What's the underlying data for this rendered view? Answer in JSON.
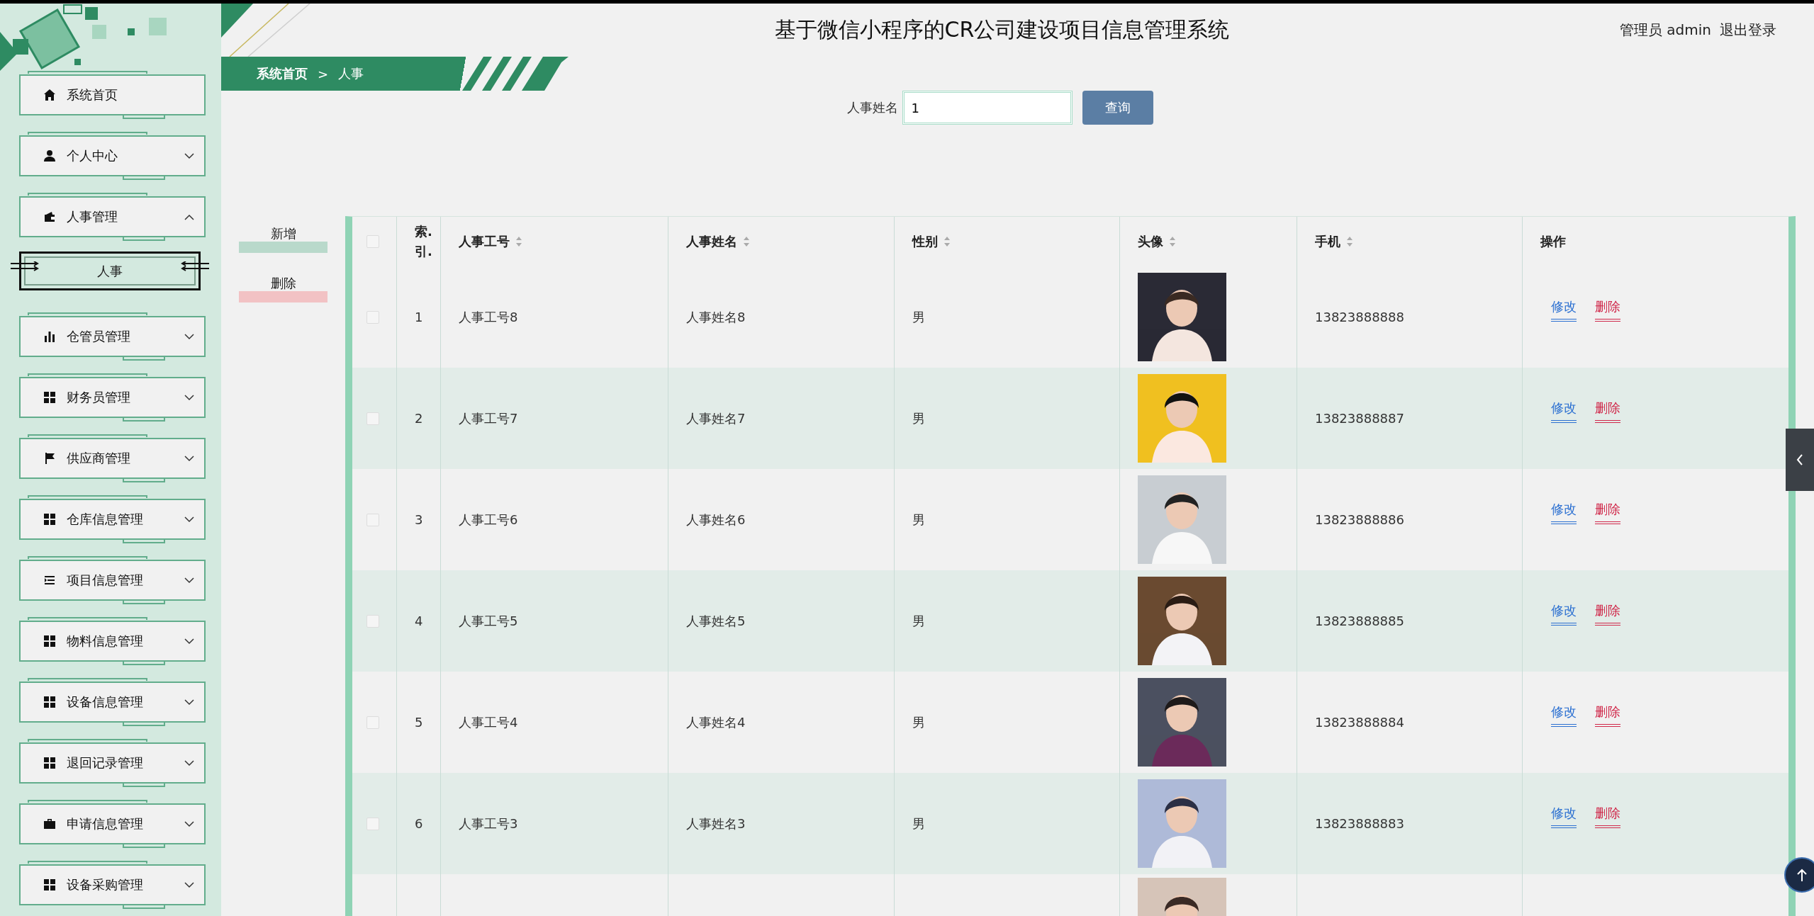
{
  "header": {
    "title": "基于微信小程序的CR公司建设项目信息管理系统",
    "user": "管理员 admin",
    "logout": "退出登录"
  },
  "sidebar": {
    "items": [
      {
        "kind": "link",
        "label": "系统首页"
      },
      {
        "kind": "menu",
        "label": "个人中心",
        "expanded": false
      },
      {
        "kind": "menu",
        "label": "人事管理",
        "expanded": true,
        "children": [
          {
            "label": "人事",
            "selected": true
          }
        ]
      },
      {
        "kind": "menu",
        "label": "仓管员管理",
        "expanded": false
      },
      {
        "kind": "menu",
        "label": "财务员管理",
        "expanded": false
      },
      {
        "kind": "menu",
        "label": "供应商管理",
        "expanded": false
      },
      {
        "kind": "menu",
        "label": "仓库信息管理",
        "expanded": false
      },
      {
        "kind": "menu",
        "label": "项目信息管理",
        "expanded": false
      },
      {
        "kind": "menu",
        "label": "物料信息管理",
        "expanded": false
      },
      {
        "kind": "menu",
        "label": "设备信息管理",
        "expanded": false
      },
      {
        "kind": "menu",
        "label": "退回记录管理",
        "expanded": false
      },
      {
        "kind": "menu",
        "label": "申请信息管理",
        "expanded": false
      },
      {
        "kind": "menu",
        "label": "设备采购管理",
        "expanded": false
      }
    ]
  },
  "breadcrumb": {
    "home": "系统首页",
    "separator": ">",
    "current": "人事"
  },
  "search": {
    "label": "人事姓名",
    "value": "1",
    "button": "查询"
  },
  "actions": [
    {
      "kind": "add",
      "label": "新增"
    },
    {
      "kind": "delete",
      "label": "删除"
    }
  ],
  "table": {
    "header_checkbox": {
      "checked": false
    },
    "columns": [
      {
        "label": "索.\n引.",
        "sortable": false
      },
      {
        "label": "人事工号",
        "sortable": true
      },
      {
        "label": "人事姓名",
        "sortable": true
      },
      {
        "label": "性别",
        "sortable": true
      },
      {
        "label": "头像",
        "sortable": true
      },
      {
        "label": "手机",
        "sortable": true
      },
      {
        "label": "操作",
        "sortable": false
      }
    ],
    "rows": [
      {
        "kind": "data",
        "selected": false,
        "index": "1",
        "staff_no": "人事工号8",
        "name": "人事姓名8",
        "gender": "男",
        "phone": "13823888888",
        "actions": [
          {
            "kind": "edit",
            "label": "修改"
          },
          {
            "kind": "delete",
            "label": "删除"
          }
        ]
      },
      {
        "kind": "data",
        "selected": false,
        "index": "2",
        "staff_no": "人事工号7",
        "name": "人事姓名7",
        "gender": "男",
        "phone": "13823888887",
        "actions": [
          {
            "kind": "edit",
            "label": "修改"
          },
          {
            "kind": "delete",
            "label": "删除"
          }
        ]
      },
      {
        "kind": "data",
        "selected": false,
        "index": "3",
        "staff_no": "人事工号6",
        "name": "人事姓名6",
        "gender": "男",
        "phone": "13823888886",
        "actions": [
          {
            "kind": "edit",
            "label": "修改"
          },
          {
            "kind": "delete",
            "label": "删除"
          }
        ]
      },
      {
        "kind": "data",
        "selected": false,
        "index": "4",
        "staff_no": "人事工号5",
        "name": "人事姓名5",
        "gender": "男",
        "phone": "13823888885",
        "actions": [
          {
            "kind": "edit",
            "label": "修改"
          },
          {
            "kind": "delete",
            "label": "删除"
          }
        ]
      },
      {
        "kind": "data",
        "selected": false,
        "index": "5",
        "staff_no": "人事工号4",
        "name": "人事姓名4",
        "gender": "男",
        "phone": "13823888884",
        "actions": [
          {
            "kind": "edit",
            "label": "修改"
          },
          {
            "kind": "delete",
            "label": "删除"
          }
        ]
      },
      {
        "kind": "data",
        "selected": false,
        "index": "6",
        "staff_no": "人事工号3",
        "name": "人事姓名3",
        "gender": "男",
        "phone": "13823888883",
        "actions": [
          {
            "kind": "edit",
            "label": "修改"
          },
          {
            "kind": "delete",
            "label": "删除"
          }
        ]
      },
      {
        "kind": "partial"
      }
    ]
  }
}
